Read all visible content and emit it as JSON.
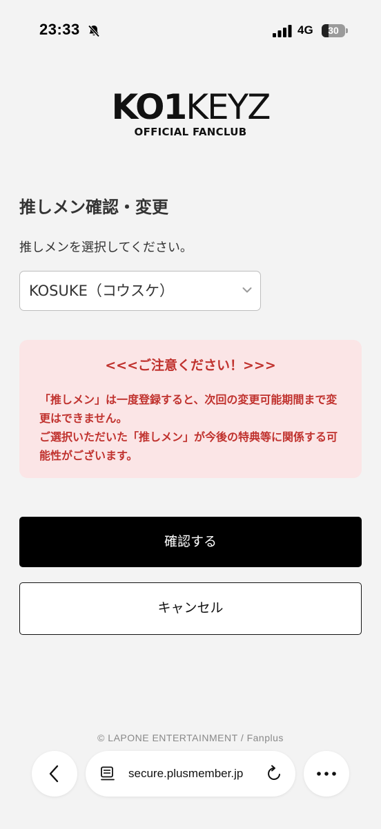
{
  "status_bar": {
    "time": "23:33",
    "network": "4G",
    "battery_level": "30",
    "battery_fraction": 0.3,
    "icons": [
      "bell-slash-icon",
      "signal-icon",
      "battery-icon"
    ]
  },
  "logo": {
    "part_bold": "KO1",
    "part_light": "KEYZ",
    "subtitle": "OFFICIAL FANCLUB"
  },
  "page": {
    "title": "推しメン確認・変更",
    "instruction": "推しメンを選択してください。",
    "select": {
      "value": "KOSUKE（コウスケ）",
      "icon": "chevron-down-icon"
    },
    "notice": {
      "title": "<<<ご注意ください！>>>",
      "body": "「推しメン」は一度登録すると、次回の変更可能期間まで変更はできません。\nご選択いただいた「推しメン」が今後の特典等に関係する可能性がございます。"
    },
    "confirm_label": "確認する",
    "cancel_label": "キャンセル",
    "copyright": "© LAPONE ENTERTAINMENT / Fanplus"
  },
  "browser": {
    "url": "secure.plusmember.jp",
    "icons": [
      "back-icon",
      "page-icon",
      "reload-icon",
      "more-icon"
    ]
  },
  "colors": {
    "background": "#f3f3f3",
    "notice_background": "#fbe5e6",
    "notice_text": "#c0322e",
    "primary_button": "#000000"
  }
}
